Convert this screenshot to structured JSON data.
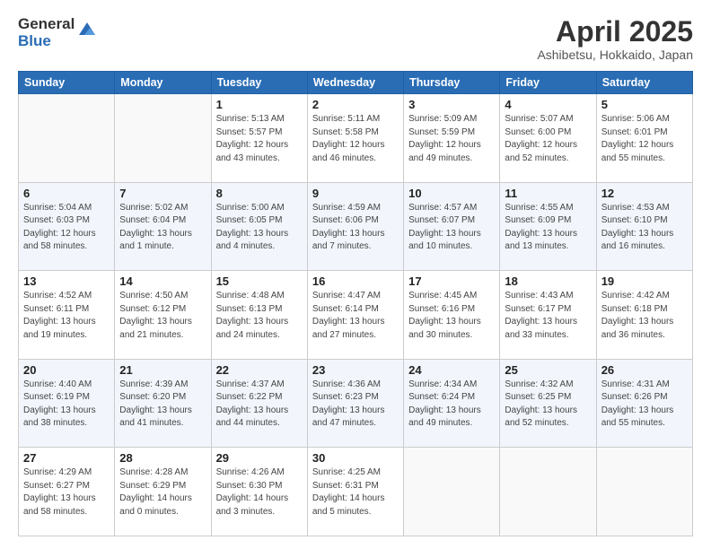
{
  "logo": {
    "general": "General",
    "blue": "Blue"
  },
  "title": "April 2025",
  "subtitle": "Ashibetsu, Hokkaido, Japan",
  "weekdays": [
    "Sunday",
    "Monday",
    "Tuesday",
    "Wednesday",
    "Thursday",
    "Friday",
    "Saturday"
  ],
  "weeks": [
    [
      {
        "day": "",
        "info": ""
      },
      {
        "day": "",
        "info": ""
      },
      {
        "day": "1",
        "info": "Sunrise: 5:13 AM\nSunset: 5:57 PM\nDaylight: 12 hours\nand 43 minutes."
      },
      {
        "day": "2",
        "info": "Sunrise: 5:11 AM\nSunset: 5:58 PM\nDaylight: 12 hours\nand 46 minutes."
      },
      {
        "day": "3",
        "info": "Sunrise: 5:09 AM\nSunset: 5:59 PM\nDaylight: 12 hours\nand 49 minutes."
      },
      {
        "day": "4",
        "info": "Sunrise: 5:07 AM\nSunset: 6:00 PM\nDaylight: 12 hours\nand 52 minutes."
      },
      {
        "day": "5",
        "info": "Sunrise: 5:06 AM\nSunset: 6:01 PM\nDaylight: 12 hours\nand 55 minutes."
      }
    ],
    [
      {
        "day": "6",
        "info": "Sunrise: 5:04 AM\nSunset: 6:03 PM\nDaylight: 12 hours\nand 58 minutes."
      },
      {
        "day": "7",
        "info": "Sunrise: 5:02 AM\nSunset: 6:04 PM\nDaylight: 13 hours\nand 1 minute."
      },
      {
        "day": "8",
        "info": "Sunrise: 5:00 AM\nSunset: 6:05 PM\nDaylight: 13 hours\nand 4 minutes."
      },
      {
        "day": "9",
        "info": "Sunrise: 4:59 AM\nSunset: 6:06 PM\nDaylight: 13 hours\nand 7 minutes."
      },
      {
        "day": "10",
        "info": "Sunrise: 4:57 AM\nSunset: 6:07 PM\nDaylight: 13 hours\nand 10 minutes."
      },
      {
        "day": "11",
        "info": "Sunrise: 4:55 AM\nSunset: 6:09 PM\nDaylight: 13 hours\nand 13 minutes."
      },
      {
        "day": "12",
        "info": "Sunrise: 4:53 AM\nSunset: 6:10 PM\nDaylight: 13 hours\nand 16 minutes."
      }
    ],
    [
      {
        "day": "13",
        "info": "Sunrise: 4:52 AM\nSunset: 6:11 PM\nDaylight: 13 hours\nand 19 minutes."
      },
      {
        "day": "14",
        "info": "Sunrise: 4:50 AM\nSunset: 6:12 PM\nDaylight: 13 hours\nand 21 minutes."
      },
      {
        "day": "15",
        "info": "Sunrise: 4:48 AM\nSunset: 6:13 PM\nDaylight: 13 hours\nand 24 minutes."
      },
      {
        "day": "16",
        "info": "Sunrise: 4:47 AM\nSunset: 6:14 PM\nDaylight: 13 hours\nand 27 minutes."
      },
      {
        "day": "17",
        "info": "Sunrise: 4:45 AM\nSunset: 6:16 PM\nDaylight: 13 hours\nand 30 minutes."
      },
      {
        "day": "18",
        "info": "Sunrise: 4:43 AM\nSunset: 6:17 PM\nDaylight: 13 hours\nand 33 minutes."
      },
      {
        "day": "19",
        "info": "Sunrise: 4:42 AM\nSunset: 6:18 PM\nDaylight: 13 hours\nand 36 minutes."
      }
    ],
    [
      {
        "day": "20",
        "info": "Sunrise: 4:40 AM\nSunset: 6:19 PM\nDaylight: 13 hours\nand 38 minutes."
      },
      {
        "day": "21",
        "info": "Sunrise: 4:39 AM\nSunset: 6:20 PM\nDaylight: 13 hours\nand 41 minutes."
      },
      {
        "day": "22",
        "info": "Sunrise: 4:37 AM\nSunset: 6:22 PM\nDaylight: 13 hours\nand 44 minutes."
      },
      {
        "day": "23",
        "info": "Sunrise: 4:36 AM\nSunset: 6:23 PM\nDaylight: 13 hours\nand 47 minutes."
      },
      {
        "day": "24",
        "info": "Sunrise: 4:34 AM\nSunset: 6:24 PM\nDaylight: 13 hours\nand 49 minutes."
      },
      {
        "day": "25",
        "info": "Sunrise: 4:32 AM\nSunset: 6:25 PM\nDaylight: 13 hours\nand 52 minutes."
      },
      {
        "day": "26",
        "info": "Sunrise: 4:31 AM\nSunset: 6:26 PM\nDaylight: 13 hours\nand 55 minutes."
      }
    ],
    [
      {
        "day": "27",
        "info": "Sunrise: 4:29 AM\nSunset: 6:27 PM\nDaylight: 13 hours\nand 58 minutes."
      },
      {
        "day": "28",
        "info": "Sunrise: 4:28 AM\nSunset: 6:29 PM\nDaylight: 14 hours\nand 0 minutes."
      },
      {
        "day": "29",
        "info": "Sunrise: 4:26 AM\nSunset: 6:30 PM\nDaylight: 14 hours\nand 3 minutes."
      },
      {
        "day": "30",
        "info": "Sunrise: 4:25 AM\nSunset: 6:31 PM\nDaylight: 14 hours\nand 5 minutes."
      },
      {
        "day": "",
        "info": ""
      },
      {
        "day": "",
        "info": ""
      },
      {
        "day": "",
        "info": ""
      }
    ]
  ]
}
